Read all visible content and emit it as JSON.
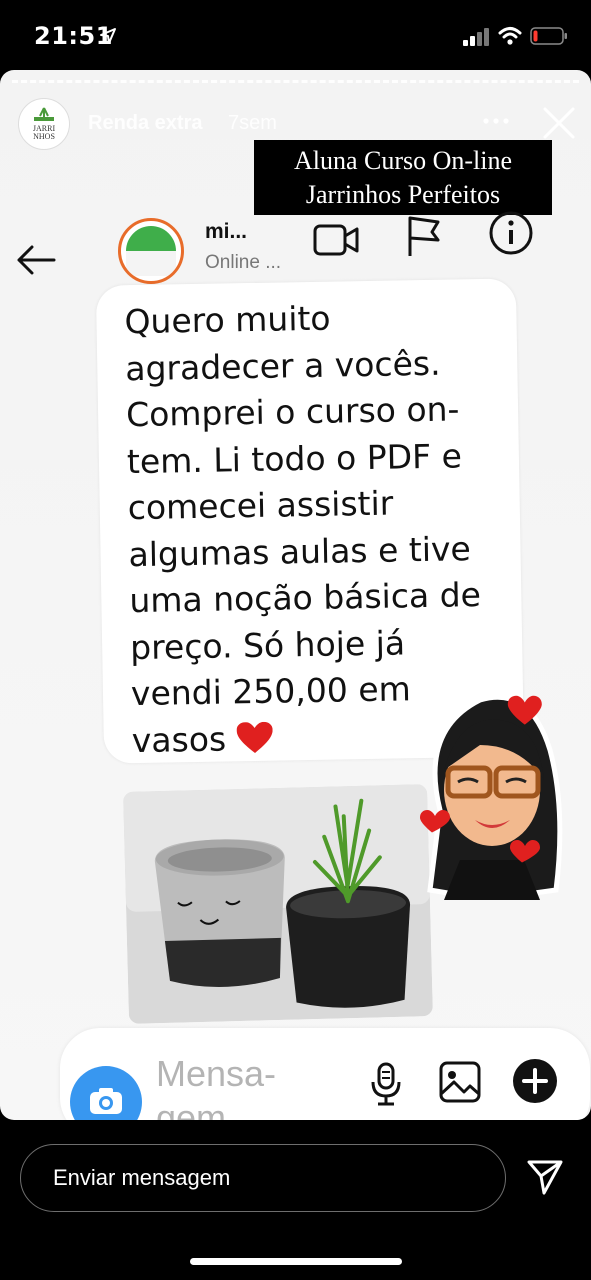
{
  "status_bar": {
    "time": "21:51",
    "battery_level": 0.15,
    "battery_color": "#ff3b30"
  },
  "story": {
    "username": "Renda extra",
    "time_ago": "7sem",
    "caption_line1": "Aluna Curso On-line",
    "caption_line2": "Jarrinhos Perfeitos",
    "more_icon": "more-horizontal-icon",
    "close_icon": "close-icon"
  },
  "chat": {
    "contact_name": "mi...",
    "contact_status": "Online ...",
    "message": "Quero muito agradecer a vocês. Comprei o curso on-tem. Li todo o PDF e comecei assistir algumas aulas e tive uma noção básica de preço. Só hoje já vendi 250,00 em vasos",
    "composer_placeholder": "Mensa-gem",
    "icons": [
      "back-arrow-icon",
      "video-camera-icon",
      "flag-icon",
      "info-icon",
      "camera-icon",
      "microphone-icon",
      "gallery-icon",
      "plus-icon"
    ]
  },
  "reply": {
    "placeholder": "Enviar mensagem"
  },
  "colors": {
    "accent_blue": "#3897f0",
    "heart_red": "#e0201f",
    "caption_bg": "#000000"
  }
}
